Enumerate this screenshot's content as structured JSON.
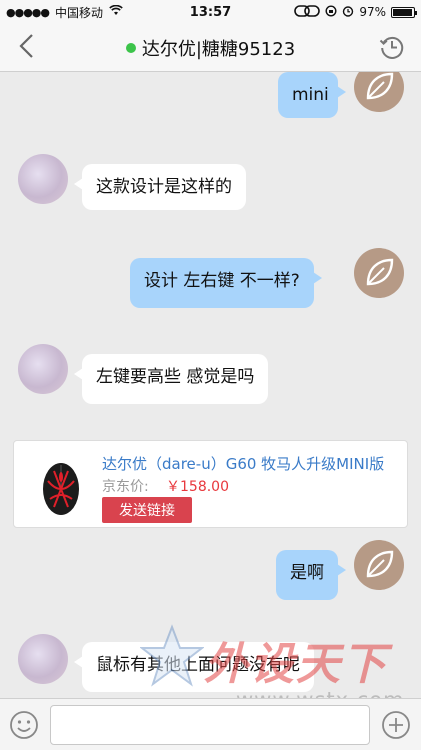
{
  "status_bar": {
    "signal": "●●●●●",
    "carrier": "中国移动",
    "time": "13:57",
    "battery_text": "97%",
    "battery_level": 0.97
  },
  "nav": {
    "title": "达尔优|糖糖95123",
    "online_color": "#3cc44a",
    "back_icon": "chevron-left-icon",
    "history_icon": "clock-history-icon"
  },
  "messages": [
    {
      "side": "right",
      "text": "mini"
    },
    {
      "side": "left",
      "text": "这款设计是这样的"
    },
    {
      "side": "right",
      "text": "设计 左右键 不一样?"
    },
    {
      "side": "left",
      "text": "左键要高些 感觉是吗"
    },
    {
      "side": "right",
      "text": "是啊"
    },
    {
      "side": "left",
      "text": "鼠标有其他上面问题没有呢"
    }
  ],
  "product_card": {
    "title": "达尔优（dare-u）G60 牧马人升级MINI版",
    "price_label": "京东价:",
    "price": "￥158.00",
    "button_label": "发送链接"
  },
  "watermark": {
    "text": "外设天下",
    "url": "www.wstx.com"
  },
  "input_bar": {
    "placeholder": "",
    "emoji_icon": "smiley-icon",
    "plus_icon": "plus-circle-icon"
  },
  "colors": {
    "bubble_right": "#a8d4fb",
    "bubble_left": "#ffffff",
    "price": "#e8383d",
    "link": "#3a7bc8",
    "button": "#d9434e"
  }
}
